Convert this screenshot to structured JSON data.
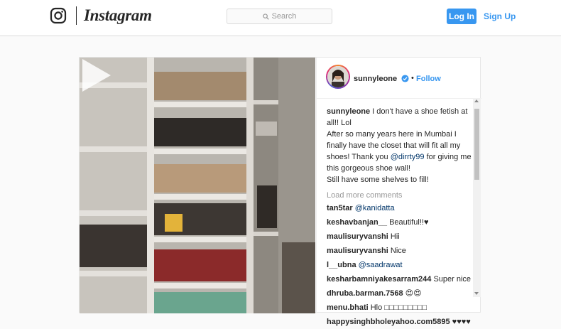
{
  "nav": {
    "brand": "Instagram",
    "search_placeholder": "Search",
    "login_label": "Log In",
    "signup_label": "Sign Up"
  },
  "colors": {
    "accent": "#3897f0",
    "border": "#dbdbdb",
    "background": "#fafafa"
  },
  "icons": {
    "brand_glyph": "instagram-camera-glyph",
    "search": "magnifier",
    "verified": "blue-check-badge",
    "play": "play-triangle"
  },
  "post": {
    "media_type": "video",
    "author": {
      "username": "sunnyleone",
      "verified": true,
      "dot": "•",
      "follow_label": "Follow"
    },
    "caption": {
      "username": "sunnyleone",
      "text_1": " I don't have a shoe fetish at all!! Lol",
      "text_2": "After so many years here in Mumbai I finally have the closet that will fit all my shoes! Thank you ",
      "mention": "@dirrty99",
      "text_3": " for giving me this gorgeous shoe wall!",
      "text_4": "Still have some shelves to fill!"
    },
    "load_more": "Load more comments",
    "comments": [
      {
        "username": "tan5tar",
        "text": "@kanidatta",
        "is_mention": true
      },
      {
        "username": "keshavbanjan__",
        "text": "Beautiful!!♥",
        "is_mention": false
      },
      {
        "username": "maulisuryvanshi",
        "text": "Hii",
        "is_mention": false
      },
      {
        "username": "maulisuryvanshi",
        "text": "Nice",
        "is_mention": false
      },
      {
        "username": "l__ubna",
        "text": "@saadrawat",
        "is_mention": true
      },
      {
        "username": "kesharbamniyakesarram244",
        "text": "Super nice",
        "is_mention": false
      },
      {
        "username": "dhruba.barman.7568",
        "text": "😍😍",
        "is_mention": false
      },
      {
        "username": "menu.bhati",
        "text": "Hlo □□□□□□□□□",
        "is_mention": false
      },
      {
        "username": "happysinghbholeyahoo.com5895",
        "text": "♥♥♥♥",
        "is_mention": false
      }
    ]
  }
}
